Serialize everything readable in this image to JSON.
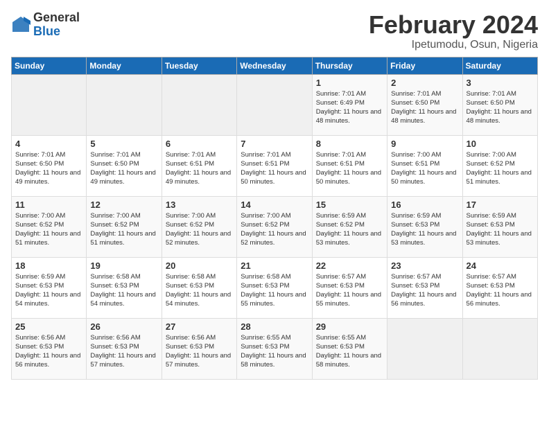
{
  "logo": {
    "general": "General",
    "blue": "Blue"
  },
  "title": "February 2024",
  "subtitle": "Ipetumodu, Osun, Nigeria",
  "days_header": [
    "Sunday",
    "Monday",
    "Tuesday",
    "Wednesday",
    "Thursday",
    "Friday",
    "Saturday"
  ],
  "weeks": [
    [
      {
        "day": "",
        "info": ""
      },
      {
        "day": "",
        "info": ""
      },
      {
        "day": "",
        "info": ""
      },
      {
        "day": "",
        "info": ""
      },
      {
        "day": "1",
        "info": "Sunrise: 7:01 AM\nSunset: 6:49 PM\nDaylight: 11 hours and 48 minutes."
      },
      {
        "day": "2",
        "info": "Sunrise: 7:01 AM\nSunset: 6:50 PM\nDaylight: 11 hours and 48 minutes."
      },
      {
        "day": "3",
        "info": "Sunrise: 7:01 AM\nSunset: 6:50 PM\nDaylight: 11 hours and 48 minutes."
      }
    ],
    [
      {
        "day": "4",
        "info": "Sunrise: 7:01 AM\nSunset: 6:50 PM\nDaylight: 11 hours and 49 minutes."
      },
      {
        "day": "5",
        "info": "Sunrise: 7:01 AM\nSunset: 6:50 PM\nDaylight: 11 hours and 49 minutes."
      },
      {
        "day": "6",
        "info": "Sunrise: 7:01 AM\nSunset: 6:51 PM\nDaylight: 11 hours and 49 minutes."
      },
      {
        "day": "7",
        "info": "Sunrise: 7:01 AM\nSunset: 6:51 PM\nDaylight: 11 hours and 50 minutes."
      },
      {
        "day": "8",
        "info": "Sunrise: 7:01 AM\nSunset: 6:51 PM\nDaylight: 11 hours and 50 minutes."
      },
      {
        "day": "9",
        "info": "Sunrise: 7:00 AM\nSunset: 6:51 PM\nDaylight: 11 hours and 50 minutes."
      },
      {
        "day": "10",
        "info": "Sunrise: 7:00 AM\nSunset: 6:52 PM\nDaylight: 11 hours and 51 minutes."
      }
    ],
    [
      {
        "day": "11",
        "info": "Sunrise: 7:00 AM\nSunset: 6:52 PM\nDaylight: 11 hours and 51 minutes."
      },
      {
        "day": "12",
        "info": "Sunrise: 7:00 AM\nSunset: 6:52 PM\nDaylight: 11 hours and 51 minutes."
      },
      {
        "day": "13",
        "info": "Sunrise: 7:00 AM\nSunset: 6:52 PM\nDaylight: 11 hours and 52 minutes."
      },
      {
        "day": "14",
        "info": "Sunrise: 7:00 AM\nSunset: 6:52 PM\nDaylight: 11 hours and 52 minutes."
      },
      {
        "day": "15",
        "info": "Sunrise: 6:59 AM\nSunset: 6:52 PM\nDaylight: 11 hours and 53 minutes."
      },
      {
        "day": "16",
        "info": "Sunrise: 6:59 AM\nSunset: 6:53 PM\nDaylight: 11 hours and 53 minutes."
      },
      {
        "day": "17",
        "info": "Sunrise: 6:59 AM\nSunset: 6:53 PM\nDaylight: 11 hours and 53 minutes."
      }
    ],
    [
      {
        "day": "18",
        "info": "Sunrise: 6:59 AM\nSunset: 6:53 PM\nDaylight: 11 hours and 54 minutes."
      },
      {
        "day": "19",
        "info": "Sunrise: 6:58 AM\nSunset: 6:53 PM\nDaylight: 11 hours and 54 minutes."
      },
      {
        "day": "20",
        "info": "Sunrise: 6:58 AM\nSunset: 6:53 PM\nDaylight: 11 hours and 54 minutes."
      },
      {
        "day": "21",
        "info": "Sunrise: 6:58 AM\nSunset: 6:53 PM\nDaylight: 11 hours and 55 minutes."
      },
      {
        "day": "22",
        "info": "Sunrise: 6:57 AM\nSunset: 6:53 PM\nDaylight: 11 hours and 55 minutes."
      },
      {
        "day": "23",
        "info": "Sunrise: 6:57 AM\nSunset: 6:53 PM\nDaylight: 11 hours and 56 minutes."
      },
      {
        "day": "24",
        "info": "Sunrise: 6:57 AM\nSunset: 6:53 PM\nDaylight: 11 hours and 56 minutes."
      }
    ],
    [
      {
        "day": "25",
        "info": "Sunrise: 6:56 AM\nSunset: 6:53 PM\nDaylight: 11 hours and 56 minutes."
      },
      {
        "day": "26",
        "info": "Sunrise: 6:56 AM\nSunset: 6:53 PM\nDaylight: 11 hours and 57 minutes."
      },
      {
        "day": "27",
        "info": "Sunrise: 6:56 AM\nSunset: 6:53 PM\nDaylight: 11 hours and 57 minutes."
      },
      {
        "day": "28",
        "info": "Sunrise: 6:55 AM\nSunset: 6:53 PM\nDaylight: 11 hours and 58 minutes."
      },
      {
        "day": "29",
        "info": "Sunrise: 6:55 AM\nSunset: 6:53 PM\nDaylight: 11 hours and 58 minutes."
      },
      {
        "day": "",
        "info": ""
      },
      {
        "day": "",
        "info": ""
      }
    ]
  ]
}
